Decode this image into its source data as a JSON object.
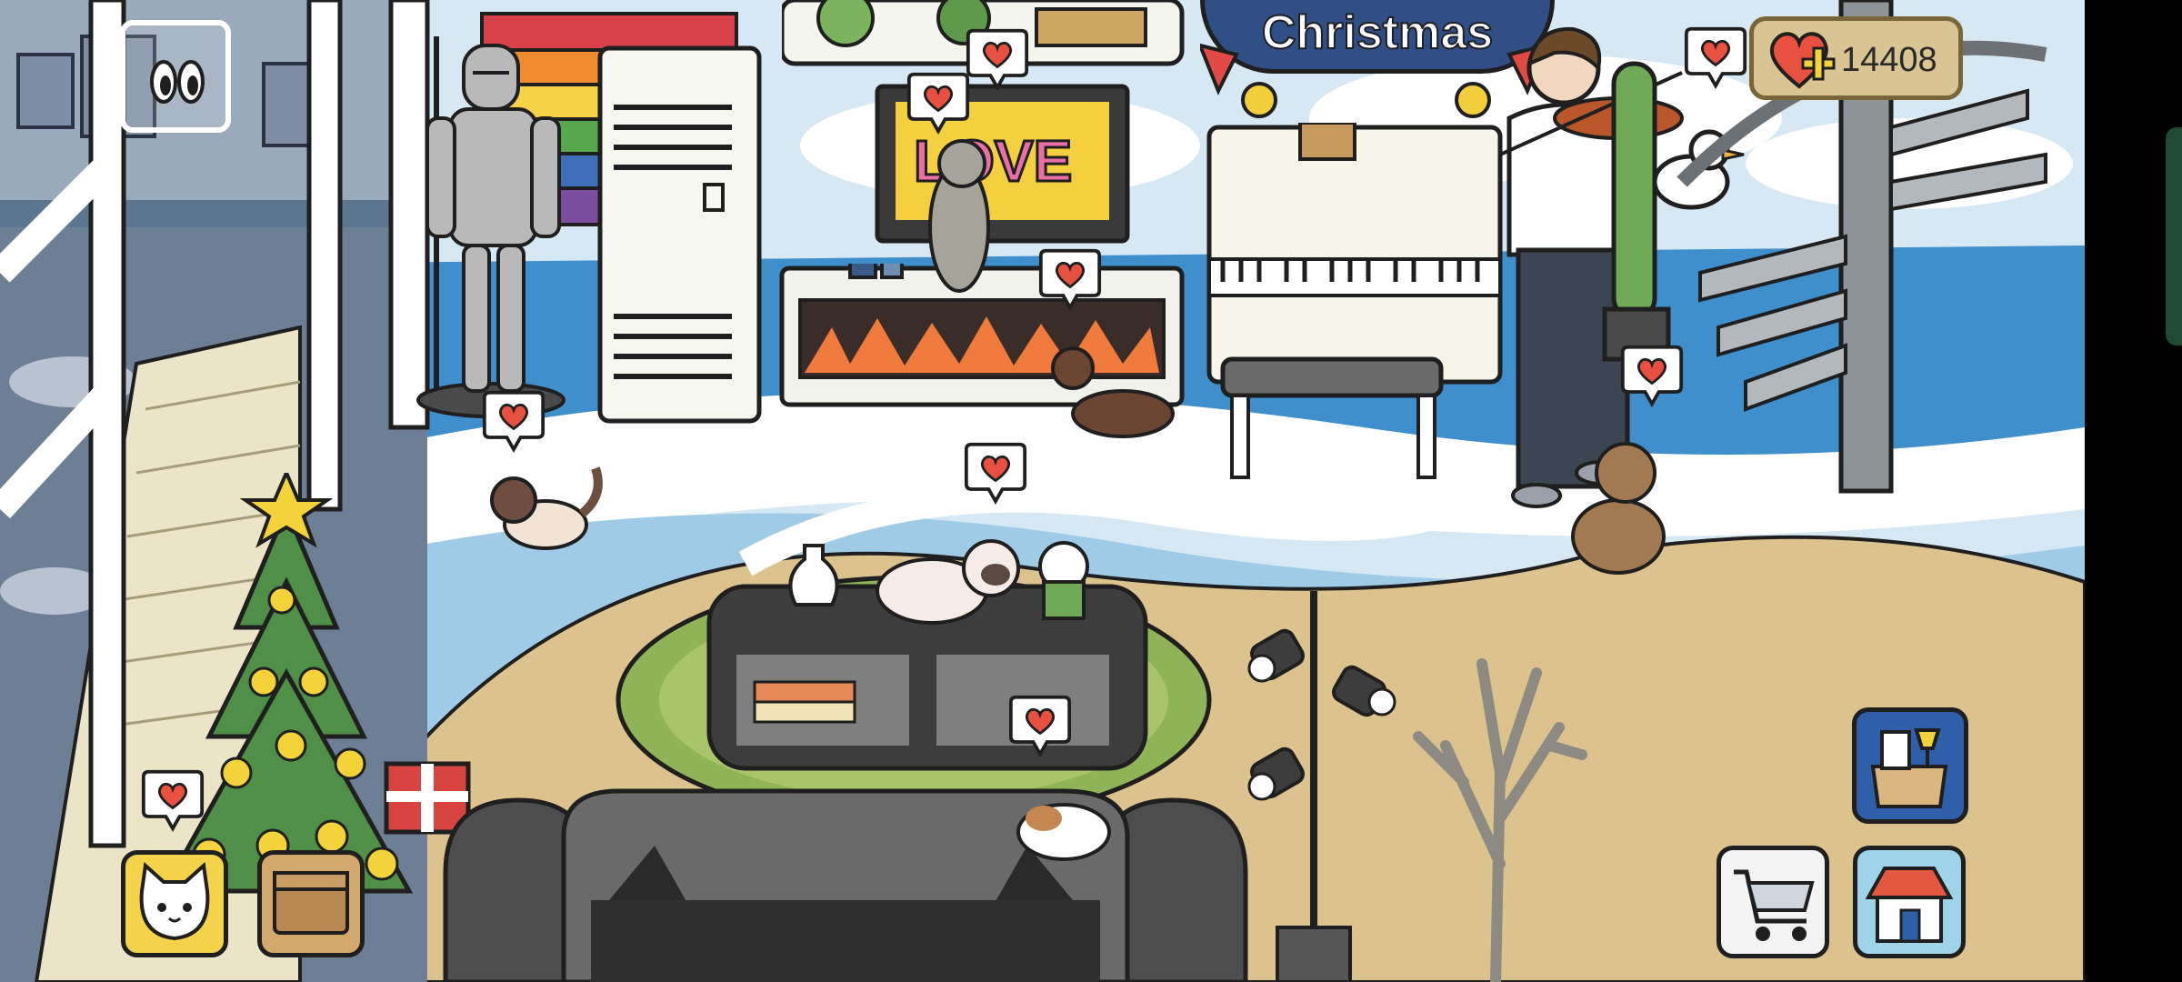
{
  "event": {
    "banner_text": "Christmas"
  },
  "currency": {
    "hearts": "14408",
    "icon": "heart-plus-icon"
  },
  "hud": {
    "menu_icon": "eyes-menu-icon",
    "cat_button_icon": "cat-face-icon",
    "box_button_icon": "box-icon",
    "furniture_button_icon": "furniture-box-icon",
    "shop_button_icon": "shopping-cart-icon",
    "home_button_icon": "house-icon"
  },
  "love_sign_text": "LOVE",
  "colors": {
    "sand": "#dcc28d",
    "sea": "#3e8fcc",
    "banner": "#2f4f86",
    "heart": "#e8513f",
    "panel": "#d9c493",
    "accent_blue": "#2e5fa8"
  }
}
